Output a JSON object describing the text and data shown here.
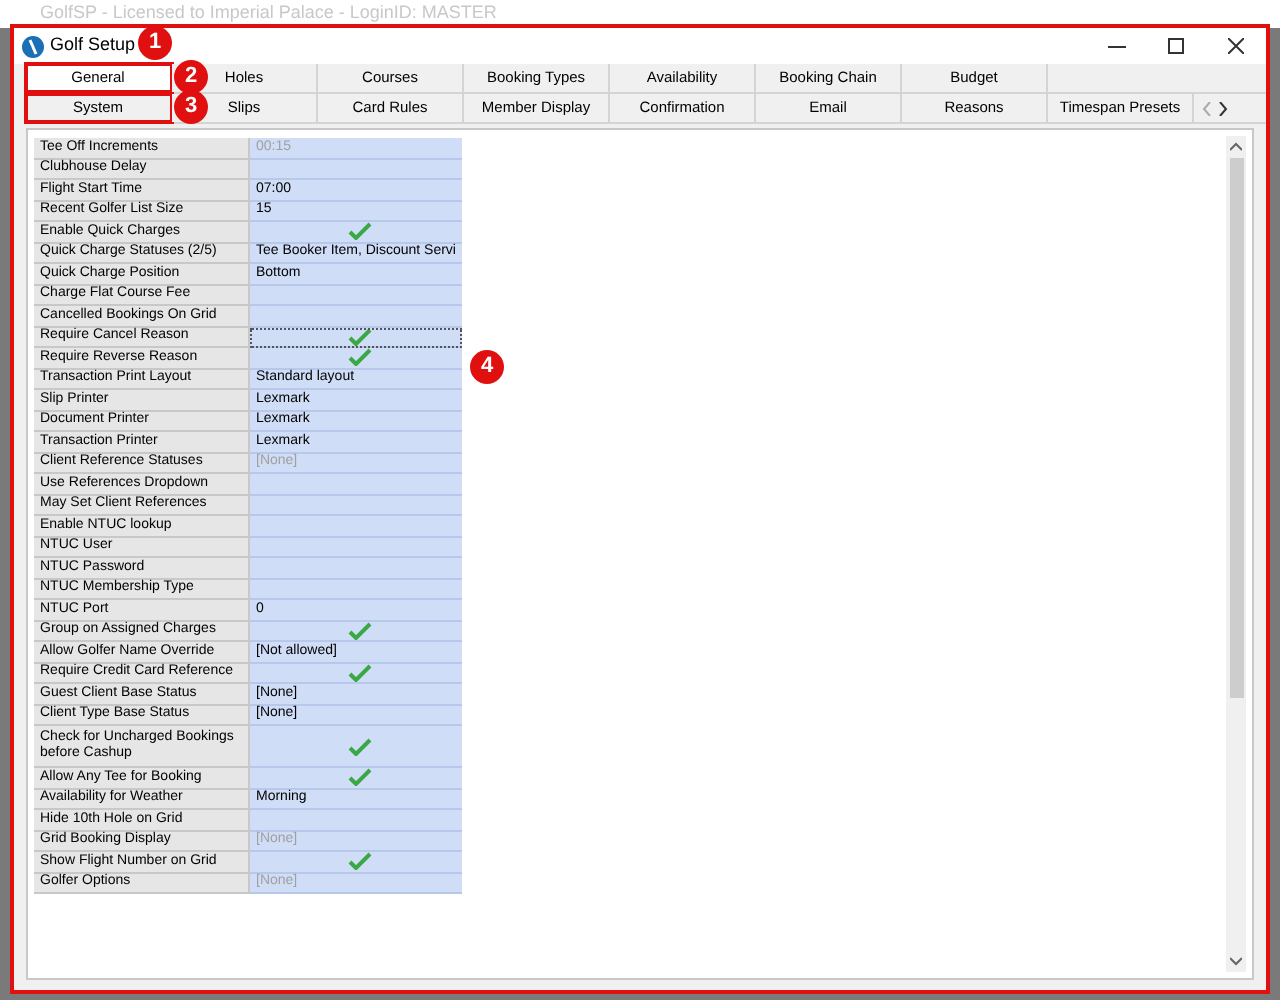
{
  "background_window": {
    "title": "GolfSP - Licensed to Imperial Palace - LoginID: MASTER"
  },
  "dialog": {
    "title": "Golf Setup",
    "annotation": "1"
  },
  "tab_rows": [
    [
      {
        "label": "General",
        "selected": true,
        "annotation": "2"
      },
      {
        "label": "Holes",
        "selected": false
      },
      {
        "label": "Courses",
        "selected": false
      },
      {
        "label": "Booking Types",
        "selected": false
      },
      {
        "label": "Availability",
        "selected": false
      },
      {
        "label": "Booking Chain",
        "selected": false
      },
      {
        "label": "Budget",
        "selected": false
      }
    ],
    [
      {
        "label": "System",
        "selected": false,
        "annotation": "3"
      },
      {
        "label": "Slips",
        "selected": false
      },
      {
        "label": "Card Rules",
        "selected": false
      },
      {
        "label": "Member Display",
        "selected": false
      },
      {
        "label": "Confirmation",
        "selected": false
      },
      {
        "label": "Email",
        "selected": false
      },
      {
        "label": "Reasons",
        "selected": false
      },
      {
        "label": "Timespan Presets",
        "selected": false
      }
    ]
  ],
  "grid": {
    "annotation": "4",
    "rows": [
      {
        "label": "Tee Off Increments",
        "kind": "text",
        "value": "00:15",
        "dim": true,
        "selected": false
      },
      {
        "label": "Clubhouse Delay",
        "kind": "text",
        "selected": false
      },
      {
        "label": "Flight Start Time",
        "kind": "text",
        "value": "07:00",
        "dim": false,
        "selected": false
      },
      {
        "label": "Recent Golfer List Size",
        "kind": "text",
        "value": "15",
        "dim": false,
        "selected": false
      },
      {
        "label": "Enable Quick Charges",
        "kind": "check",
        "checked": true,
        "selected": false
      },
      {
        "label": "Quick Charge Statuses (2/5)",
        "kind": "text",
        "value": "Tee Booker Item, Discount Servi",
        "dim": false,
        "selected": false
      },
      {
        "label": "Quick Charge Position",
        "kind": "text",
        "value": "Bottom",
        "dim": false,
        "selected": false
      },
      {
        "label": "Charge Flat Course Fee",
        "kind": "check",
        "checked": false,
        "selected": false
      },
      {
        "label": "Cancelled Bookings On Grid",
        "kind": "check",
        "checked": false,
        "selected": false
      },
      {
        "label": "Require Cancel Reason",
        "kind": "check",
        "checked": true,
        "selected": true
      },
      {
        "label": "Require Reverse Reason",
        "kind": "check",
        "checked": true,
        "selected": false
      },
      {
        "label": "Transaction Print Layout",
        "kind": "text",
        "value": "Standard layout",
        "dim": false,
        "selected": false
      },
      {
        "label": "Slip Printer",
        "kind": "text",
        "value": "Lexmark",
        "dim": false,
        "selected": false
      },
      {
        "label": "Document Printer",
        "kind": "text",
        "value": "Lexmark",
        "dim": false,
        "selected": false
      },
      {
        "label": "Transaction Printer",
        "kind": "text",
        "value": "Lexmark",
        "dim": false,
        "selected": false
      },
      {
        "label": "Client Reference Statuses",
        "kind": "text",
        "value": "[None]",
        "dim": true,
        "selected": false
      },
      {
        "label": "Use References Dropdown",
        "kind": "check",
        "checked": false,
        "selected": false
      },
      {
        "label": "May Set Client References",
        "kind": "check",
        "checked": false,
        "selected": false
      },
      {
        "label": "Enable NTUC lookup",
        "kind": "check",
        "checked": false,
        "selected": false
      },
      {
        "label": "NTUC User",
        "kind": "text",
        "selected": false
      },
      {
        "label": "NTUC Password",
        "kind": "text",
        "selected": false
      },
      {
        "label": "NTUC Membership Type",
        "kind": "text",
        "selected": false
      },
      {
        "label": "NTUC Port",
        "kind": "text",
        "value": "0",
        "dim": false,
        "selected": false
      },
      {
        "label": "Group on Assigned Charges",
        "kind": "check",
        "checked": true,
        "selected": false
      },
      {
        "label": "Allow Golfer Name Override",
        "kind": "text",
        "value": "[Not allowed]",
        "dim": false,
        "selected": false
      },
      {
        "label": "Require Credit Card Reference",
        "kind": "check",
        "checked": true,
        "selected": false
      },
      {
        "label": "Guest Client Base Status",
        "kind": "text",
        "value": "[None]",
        "dim": false,
        "selected": false
      },
      {
        "label": "Client Type Base Status",
        "kind": "text",
        "value": "[None]",
        "dim": false,
        "selected": false
      },
      {
        "label": "Check for Uncharged Bookings before Cashup",
        "kind": "check",
        "checked": true,
        "selected": false
      },
      {
        "label": "Allow Any Tee for Booking",
        "kind": "check",
        "checked": true,
        "selected": false
      },
      {
        "label": "Availability for Weather",
        "kind": "text",
        "value": "Morning",
        "dim": false,
        "selected": false
      },
      {
        "label": "Hide 10th Hole on Grid",
        "kind": "check",
        "checked": false,
        "selected": false
      },
      {
        "label": "Grid Booking Display",
        "kind": "text",
        "value": "[None]",
        "dim": true,
        "selected": false
      },
      {
        "label": "Show Flight Number on Grid",
        "kind": "check",
        "checked": true,
        "selected": false
      },
      {
        "label": "Golfer Options",
        "kind": "text",
        "value": "[None]",
        "dim": true,
        "selected": false
      }
    ]
  }
}
